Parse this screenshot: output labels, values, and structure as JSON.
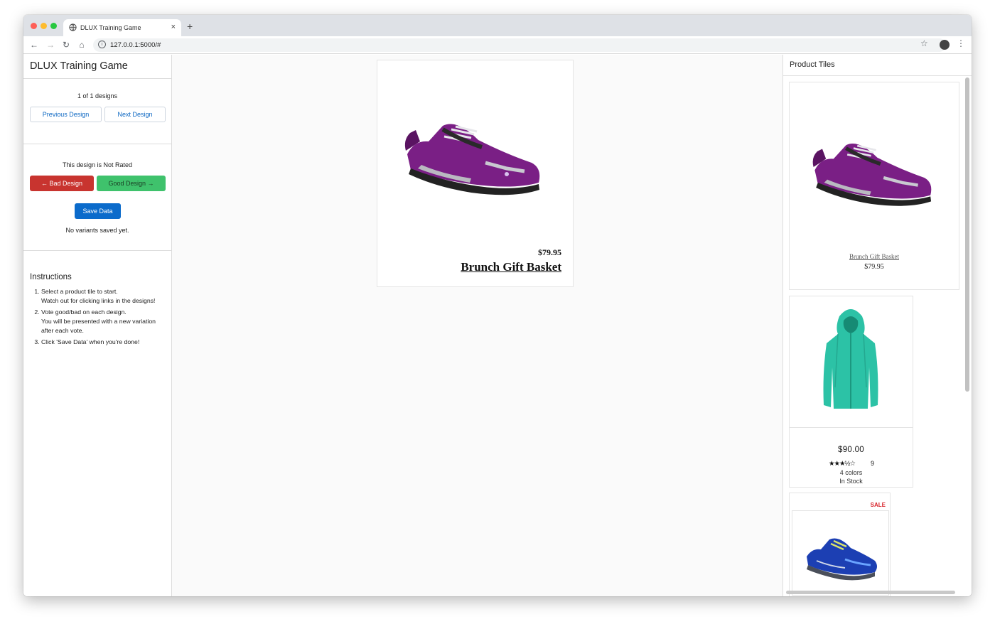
{
  "browser": {
    "tab_title": "DLUX Training Game",
    "new_tab_label": "+",
    "close_tab_label": "×",
    "url": "127.0.0.1:5000/#",
    "info_icon": "i"
  },
  "left": {
    "app_title": "DLUX Training Game",
    "design_count": "1 of 1 designs",
    "prev_label": "Previous Design",
    "next_label": "Next Design",
    "rating_status": "This design is Not Rated",
    "bad_label": "← Bad Design",
    "good_label": "Good Design →",
    "save_label": "Save Data",
    "save_status": "No variants saved yet.",
    "instructions_title": "Instructions",
    "instructions": [
      {
        "main": "Select a product tile to start.",
        "sub": "Watch out for clicking links in the designs!"
      },
      {
        "main": "Vote good/bad on each design.",
        "sub": "You will be presented with a new variation after each vote."
      },
      {
        "main": "Click 'Save Data' when you're done!",
        "sub": ""
      }
    ]
  },
  "design": {
    "price": "$79.95",
    "name": "Brunch Gift Basket"
  },
  "right": {
    "title": "Product Tiles",
    "tiles": [
      {
        "name": "Brunch Gift Basket",
        "price": "$79.95",
        "image": "purple-trail-shoe"
      },
      {
        "price": "$90.00",
        "rating_stars": "★★★½☆",
        "rating_value": 3.5,
        "review_count": "9",
        "colors": "4 colors",
        "stock": "In Stock",
        "image": "teal-fleece-jacket"
      },
      {
        "badge": "SALE",
        "image": "blue-running-shoe"
      }
    ]
  },
  "colors": {
    "bad": "#c8342f",
    "good": "#3fc26c",
    "save": "#0b6bcb",
    "link": "#0a66c2",
    "sale": "#d8232a"
  }
}
